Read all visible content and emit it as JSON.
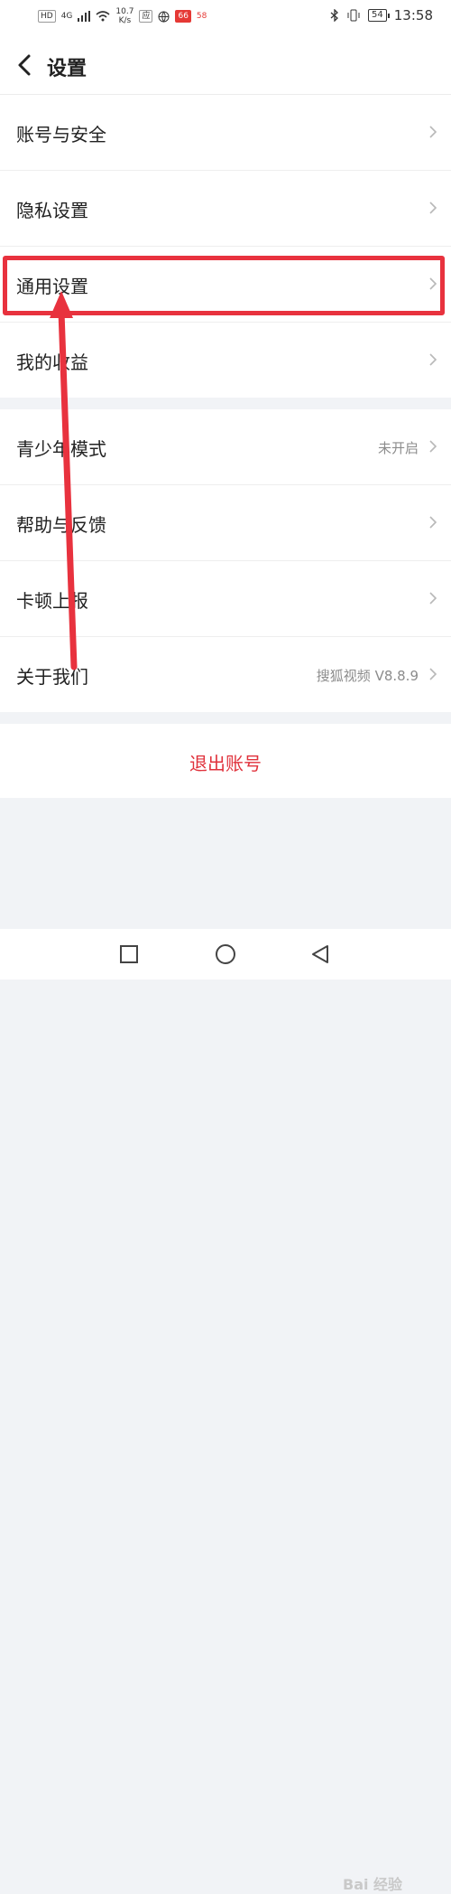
{
  "status_bar": {
    "hd": "HD",
    "net": "4G",
    "speed_value": "10.7",
    "speed_unit": "K/s",
    "app_badge_1": "应",
    "app_badge_2": "66",
    "app_badge_3": "58",
    "battery": "54",
    "time": "13:58"
  },
  "header": {
    "title": "设置"
  },
  "group1": [
    {
      "label": "账号与安全",
      "value": ""
    },
    {
      "label": "隐私设置",
      "value": ""
    },
    {
      "label": "通用设置",
      "value": ""
    },
    {
      "label": "我的收益",
      "value": ""
    }
  ],
  "group2": [
    {
      "label": "青少年模式",
      "value": "未开启"
    },
    {
      "label": "帮助与反馈",
      "value": ""
    },
    {
      "label": "卡顿上报",
      "value": ""
    },
    {
      "label": "关于我们",
      "value": "搜狐视频 V8.8.9"
    }
  ],
  "logout_label": "退出账号",
  "watermark": "Bai 经验",
  "colors": {
    "accent_red": "#e0323c",
    "annotation_red": "#e8323e"
  }
}
